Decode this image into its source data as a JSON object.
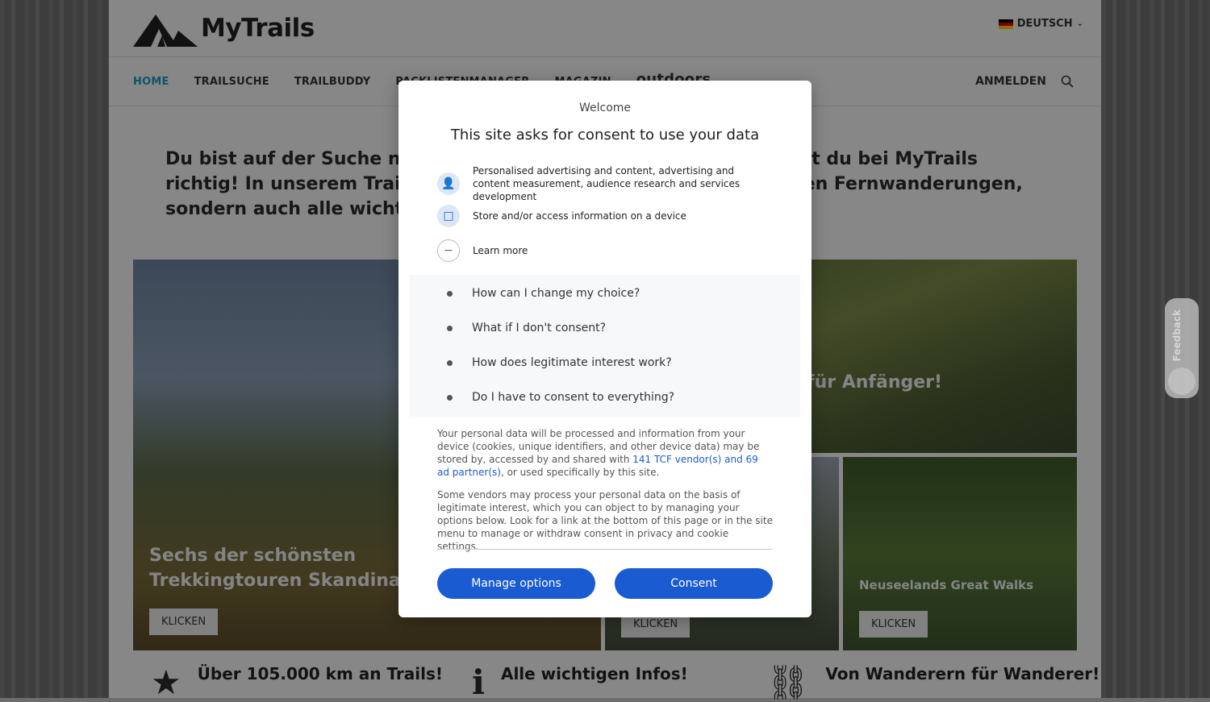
{
  "header": {
    "logo_text": "MyTrails",
    "language": "DEUTSCH"
  },
  "nav": {
    "items": [
      "HOME",
      "TRAILSUCHE",
      "TRAILBUDDY",
      "PACKLISTENMANAGER",
      "MAGAZIN"
    ],
    "partner_logo": "outdoors",
    "login": "ANMELDEN"
  },
  "intro": "Du bist auf der Suche nach einem Trekking-Abenteuer? Dann bist du bei MyTrails richtig! In unserem Trail-Finder findest du nicht nur die schönsten Fernwanderungen, sondern auch alle wichtigen Infos.",
  "tiles": {
    "big": {
      "title": "Sechs der schönsten Trekkingtouren Skandinaviens!",
      "button": "KLICKEN"
    },
    "top_right": {
      "title": "für Anfänger!"
    },
    "mid": {
      "button": "KLICKEN"
    },
    "nz": {
      "title": "Neuseelands Great Walks",
      "button": "KLICKEN"
    }
  },
  "features": [
    {
      "icon": "star-icon",
      "text": "Über 105.000 km an Trails!"
    },
    {
      "icon": "info-icon",
      "text": "Alle wichtigen Infos!"
    },
    {
      "icon": "mug-icon",
      "text": "Von Wanderern für Wanderer!"
    }
  ],
  "feedback_label": "Feedback",
  "consent": {
    "welcome": "Welcome",
    "title": "This site asks for consent to use your data",
    "purposes": [
      "Personalised advertising and content, advertising and content measurement, audience research and services development",
      "Store and/or access information on a device"
    ],
    "learn_more": "Learn more",
    "faq": [
      "How can I change my choice?",
      "What if I don't consent?",
      "How does legitimate interest work?",
      "Do I have to consent to everything?"
    ],
    "para1_pre": "Your personal data will be processed and information from your device (cookies, unique identifiers, and other device data) may be stored by, accessed by and shared with ",
    "para1_link": "141 TCF vendor(s) and 69 ad partner(s)",
    "para1_post": ", or used specifically by this site.",
    "para2": "Some vendors may process your personal data on the basis of legitimate interest, which you can object to by managing your options below. Look for a link at the bottom of this page or in the site menu to manage or withdraw consent in privacy and cookie settings.",
    "manage_button": "Manage options",
    "consent_button": "Consent"
  },
  "colors": {
    "accent": "#1a9ac0",
    "consent_blue": "#1a5bd1"
  }
}
